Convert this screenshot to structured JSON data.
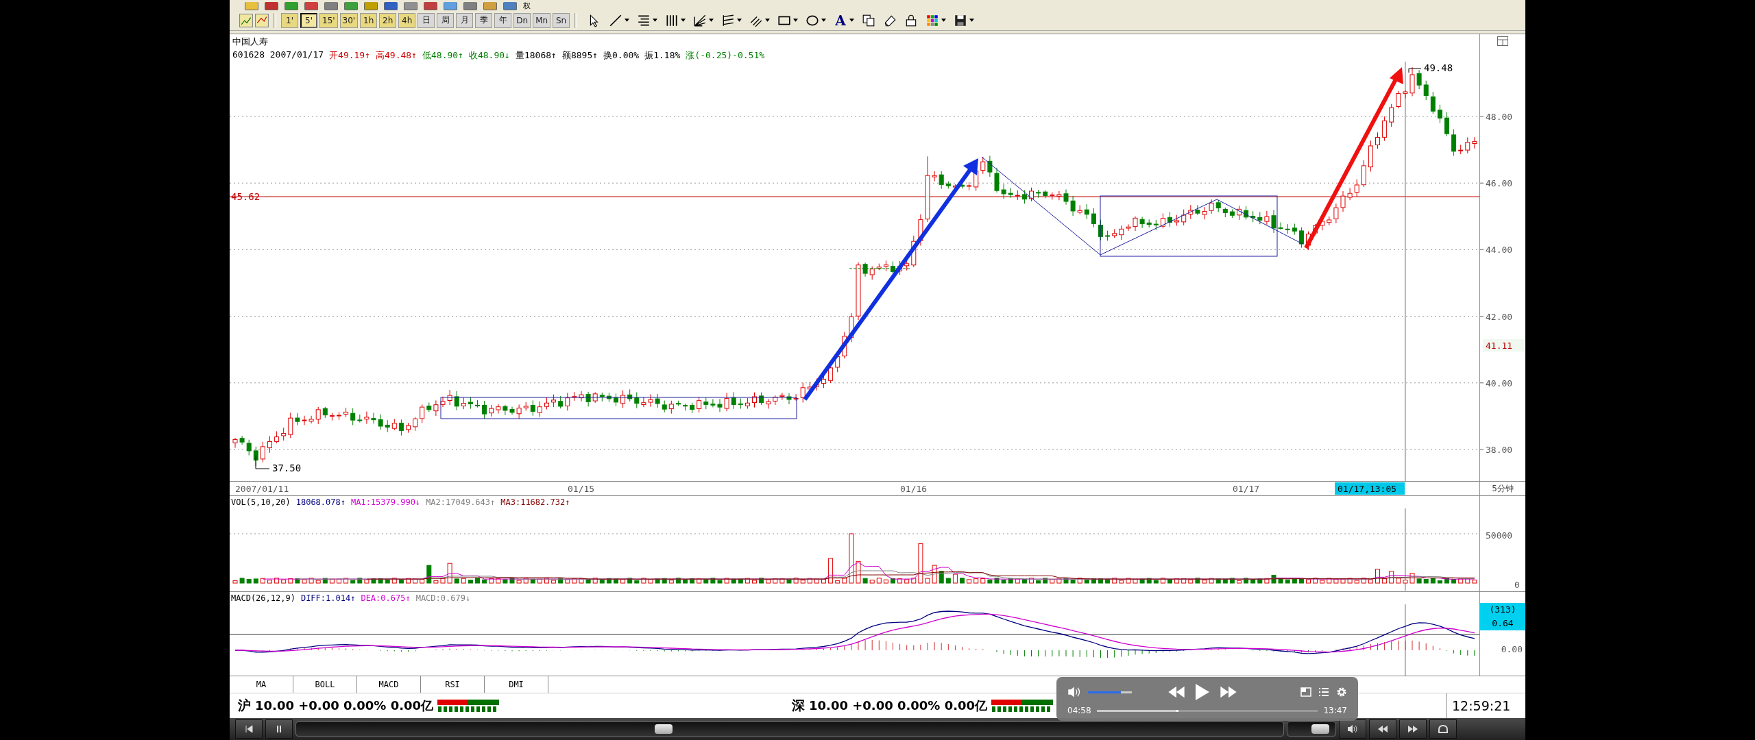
{
  "toolbar_top": {
    "label": "权"
  },
  "toolbar": {
    "periods": [
      {
        "label": "1'",
        "selected": false
      },
      {
        "label": "5'",
        "selected": true
      },
      {
        "label": "15'",
        "selected": false
      },
      {
        "label": "30'",
        "selected": false
      },
      {
        "label": "1h",
        "selected": false
      },
      {
        "label": "2h",
        "selected": false
      },
      {
        "label": "4h",
        "selected": false
      },
      {
        "label": "日",
        "selected": false
      },
      {
        "label": "周",
        "selected": false
      },
      {
        "label": "月",
        "selected": false
      },
      {
        "label": "季",
        "selected": false
      },
      {
        "label": "年",
        "selected": false
      },
      {
        "label": "Dn",
        "selected": false
      },
      {
        "label": "Mn",
        "selected": false
      },
      {
        "label": "Sn",
        "selected": false
      }
    ],
    "text_tool": "A"
  },
  "stock": {
    "name": "中国人寿",
    "quote": [
      {
        "text": "601628 2007/01/17",
        "color": "#000000"
      },
      {
        "text": "开49.19↑",
        "color": "#d00000"
      },
      {
        "text": "高49.48↑",
        "color": "#d00000"
      },
      {
        "text": "低48.90↑",
        "color": "#008000"
      },
      {
        "text": "收48.90↓",
        "color": "#008000"
      },
      {
        "text": "量18068↑",
        "color": "#000000"
      },
      {
        "text": "额8895↑",
        "color": "#000000"
      },
      {
        "text": "换0.00%",
        "color": "#000000"
      },
      {
        "text": "振1.18%",
        "color": "#000000"
      },
      {
        "text": "涨(-0.25)-0.51%",
        "color": "#008000"
      }
    ]
  },
  "price_chart": {
    "y_ticks": [
      "48.00",
      "46.00",
      "44.00",
      "42.00",
      "40.00",
      "38.00"
    ],
    "high_label": "49.48",
    "low_label": "37.50",
    "reference_label": "45.62",
    "last_price": "41.11"
  },
  "time_axis": {
    "dates": [
      "2007/01/11",
      "01/15",
      "01/16",
      "01/17"
    ],
    "cursor": "01/17,13:05",
    "period": "5分钟"
  },
  "volume": {
    "title": "VOL(5,10,20)",
    "values": [
      {
        "text": "18068.078↑",
        "color": "#000080"
      },
      {
        "text": "MA1:15379.990↓",
        "color": "#d000d0"
      },
      {
        "text": "MA2:17049.643↑",
        "color": "#808080"
      },
      {
        "text": "MA3:11682.732↑",
        "color": "#800000"
      }
    ],
    "ticks": [
      "50000",
      "0"
    ]
  },
  "macd": {
    "title": "MACD(26,12,9)",
    "values": [
      {
        "text": "DIFF:1.014↑",
        "color": "#000080"
      },
      {
        "text": "DEA:0.675↑",
        "color": "#d000d0"
      },
      {
        "text": "MACD:0.679↓",
        "color": "#808080"
      }
    ],
    "cursor_count": "(313)",
    "cursor_value": "0.64",
    "zero_tick": "0.00"
  },
  "indicator_tabs": [
    {
      "label": "MA"
    },
    {
      "label": "BOLL"
    },
    {
      "label": "MACD"
    },
    {
      "label": "RSI"
    },
    {
      "label": "DMI"
    }
  ],
  "market": [
    {
      "name": "沪",
      "summary": "10.00 +0.00 0.00% 0.00亿"
    },
    {
      "name": "深",
      "summary": "10.00 +0.00 0.00% 0.00亿"
    }
  ],
  "clock": "12:59:21",
  "video_overlay": {
    "volume": {
      "level": 0.75
    },
    "progress": {
      "level": 0.36
    },
    "elapsed": "04:58",
    "total": "13:47"
  },
  "player_bar": {
    "seek": {
      "level": 0.37
    },
    "volume": {
      "level": 0.8
    }
  }
}
